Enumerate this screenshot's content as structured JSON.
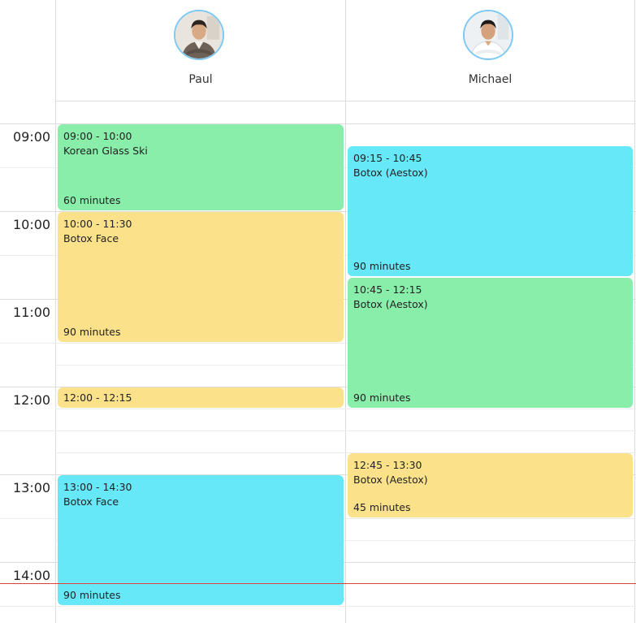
{
  "staff": [
    {
      "name": "Paul"
    },
    {
      "name": "Michael"
    }
  ],
  "times": [
    "09:00",
    "10:00",
    "11:00",
    "12:00",
    "13:00",
    "14:00"
  ],
  "appointments": {
    "paul_1": {
      "time": "09:00 - 10:00",
      "service": "Korean Glass Ski",
      "duration": "60 minutes"
    },
    "paul_2": {
      "time": "10:00 - 11:30",
      "service": "Botox Face",
      "duration": "90 minutes"
    },
    "paul_3": {
      "time": "12:00 - 12:15",
      "service": "",
      "duration": ""
    },
    "paul_4": {
      "time": "13:00 - 14:30",
      "service": "Botox Face",
      "duration": "90 minutes"
    },
    "michael_1": {
      "time": "09:15 - 10:45",
      "service": "Botox (Aestox)",
      "duration": "90 minutes"
    },
    "michael_2": {
      "time": "10:45 - 12:15",
      "service": "Botox (Aestox)",
      "duration": "90 minutes"
    },
    "michael_3": {
      "time": "12:45 - 13:30",
      "service": "Botox (Aestox)",
      "duration": "45 minutes"
    }
  },
  "colors": {
    "green": "#88eeaa",
    "yellow": "#fbe28a",
    "cyan": "#66e8f8",
    "now_line": "#e0403a",
    "avatar_ring": "#7dc9f2"
  }
}
